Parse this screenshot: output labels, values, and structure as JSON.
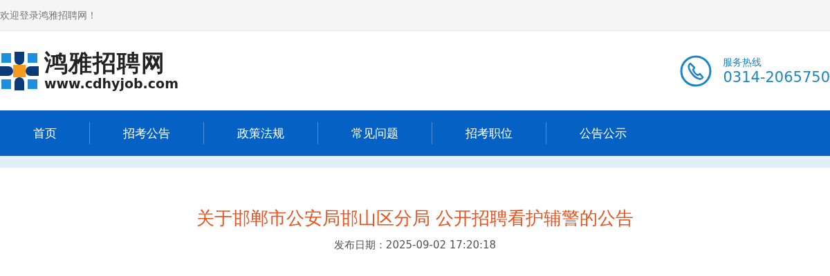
{
  "top_bar": {
    "welcome": "欢迎登录鸿雅招聘网！"
  },
  "header": {
    "logo": {
      "name": "鸿雅招聘网",
      "url": "www.cdhyjob.com"
    },
    "hotline": {
      "label": "服务热线",
      "phone": "0314-2065750"
    }
  },
  "nav": {
    "items": [
      {
        "label": "首页"
      },
      {
        "label": "招考公告"
      },
      {
        "label": "政策法规"
      },
      {
        "label": "常见问题"
      },
      {
        "label": "招考职位"
      },
      {
        "label": "公告公示"
      }
    ]
  },
  "article": {
    "title": "关于邯郸市公安局邯山区分局 公开招聘看护辅警的公告",
    "date": "发布日期：2025-09-02 17:20:18"
  }
}
